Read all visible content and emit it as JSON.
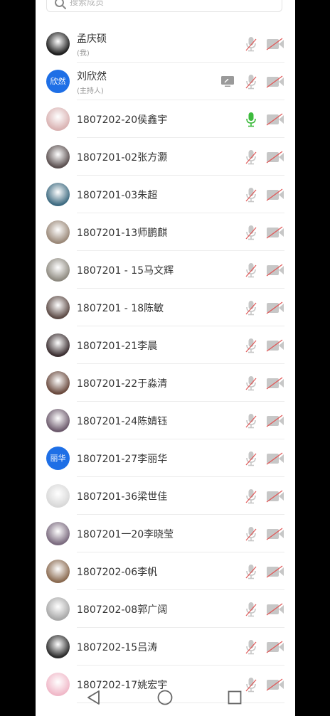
{
  "search": {
    "placeholder": "搜索成员"
  },
  "members": [
    {
      "name": "孟庆硕",
      "sub": "(我)",
      "avatar": {
        "type": "photo",
        "color": "#1c1c1c"
      },
      "mic_active": false,
      "share": false
    },
    {
      "name": "刘欣然",
      "sub": "(主持人)",
      "avatar": {
        "type": "initial",
        "text": "欣然"
      },
      "mic_active": false,
      "share": true
    },
    {
      "name": "1807202-20侯鑫宇",
      "avatar": {
        "type": "photo",
        "color": "#d9b2b2"
      },
      "mic_active": true,
      "share": false
    },
    {
      "name": "1807201-02张方灏",
      "avatar": {
        "type": "photo",
        "color": "#5a4f4f"
      },
      "mic_active": false,
      "share": false
    },
    {
      "name": "1807201-03朱超",
      "avatar": {
        "type": "photo",
        "color": "#3d6a80"
      },
      "mic_active": false,
      "share": false
    },
    {
      "name": "1807201-13师鹏麒",
      "avatar": {
        "type": "photo",
        "color": "#9a8878"
      },
      "mic_active": false,
      "share": false
    },
    {
      "name": "1807201 - 15马文辉",
      "avatar": {
        "type": "photo",
        "color": "#8e8a80"
      },
      "mic_active": false,
      "share": false
    },
    {
      "name": "1807201 - 18陈敏",
      "avatar": {
        "type": "photo",
        "color": "#5c4a45"
      },
      "mic_active": false,
      "share": false
    },
    {
      "name": "1807201-21李晨",
      "avatar": {
        "type": "photo",
        "color": "#3a2e30"
      },
      "mic_active": false,
      "share": false
    },
    {
      "name": "1807201-22于淼清",
      "avatar": {
        "type": "photo",
        "color": "#6a4a3e"
      },
      "mic_active": false,
      "share": false
    },
    {
      "name": "1807201-24陈婧钰",
      "avatar": {
        "type": "photo",
        "color": "#6c5a6c"
      },
      "mic_active": false,
      "share": false
    },
    {
      "name": "1807201-27李丽华",
      "avatar": {
        "type": "initial",
        "text": "丽华"
      },
      "mic_active": false,
      "share": false
    },
    {
      "name": "1807201-36梁世佳",
      "avatar": {
        "type": "photo",
        "color": "#d8d8d8"
      },
      "mic_active": false,
      "share": false
    },
    {
      "name": "1807201一20李晓莹",
      "avatar": {
        "type": "photo",
        "color": "#7a6a7e"
      },
      "mic_active": false,
      "share": false
    },
    {
      "name": "1807202-06李帆",
      "avatar": {
        "type": "photo",
        "color": "#8a6a50"
      },
      "mic_active": false,
      "share": false
    },
    {
      "name": "1807202-08郭广阔",
      "avatar": {
        "type": "photo",
        "color": "#a8a8a8"
      },
      "mic_active": false,
      "share": false
    },
    {
      "name": "1807202-15吕涛",
      "avatar": {
        "type": "photo",
        "color": "#2a2a2a"
      },
      "mic_active": false,
      "share": false
    },
    {
      "name": "1807202-17姚宏宇",
      "avatar": {
        "type": "photo",
        "color": "#f0b8c8"
      },
      "mic_active": false,
      "share": false
    }
  ],
  "colors": {
    "accent": "#1e6fe6",
    "mic_on": "#3dbb3d",
    "icon_gray": "#c7c7c7",
    "mute_red": "#e05a5a"
  },
  "nav": {
    "back": "back-icon",
    "home": "home-icon",
    "recents": "recents-icon"
  }
}
